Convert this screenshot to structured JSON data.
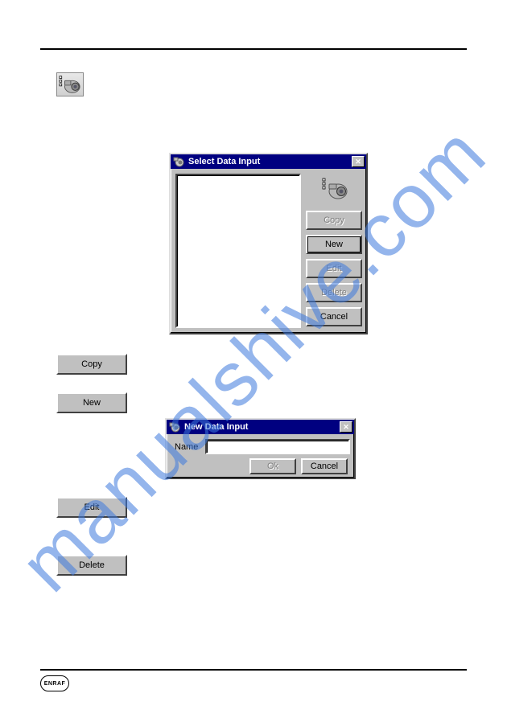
{
  "watermark": "manualshive.com",
  "dialog1": {
    "title": "Select Data Input",
    "buttons": {
      "copy": "Copy",
      "new": "New",
      "edit": "Edit",
      "delete": "Delete",
      "cancel": "Cancel"
    }
  },
  "dialog2": {
    "title": "New Data Input",
    "name_label": "Name",
    "name_value": "",
    "ok": "Ok",
    "cancel": "Cancel"
  },
  "left_buttons": {
    "copy": "Copy",
    "new": "New",
    "edit": "Edit",
    "delete": "Delete"
  },
  "footer": {
    "logo_text": "ENRAF"
  },
  "close_glyph": "✕"
}
